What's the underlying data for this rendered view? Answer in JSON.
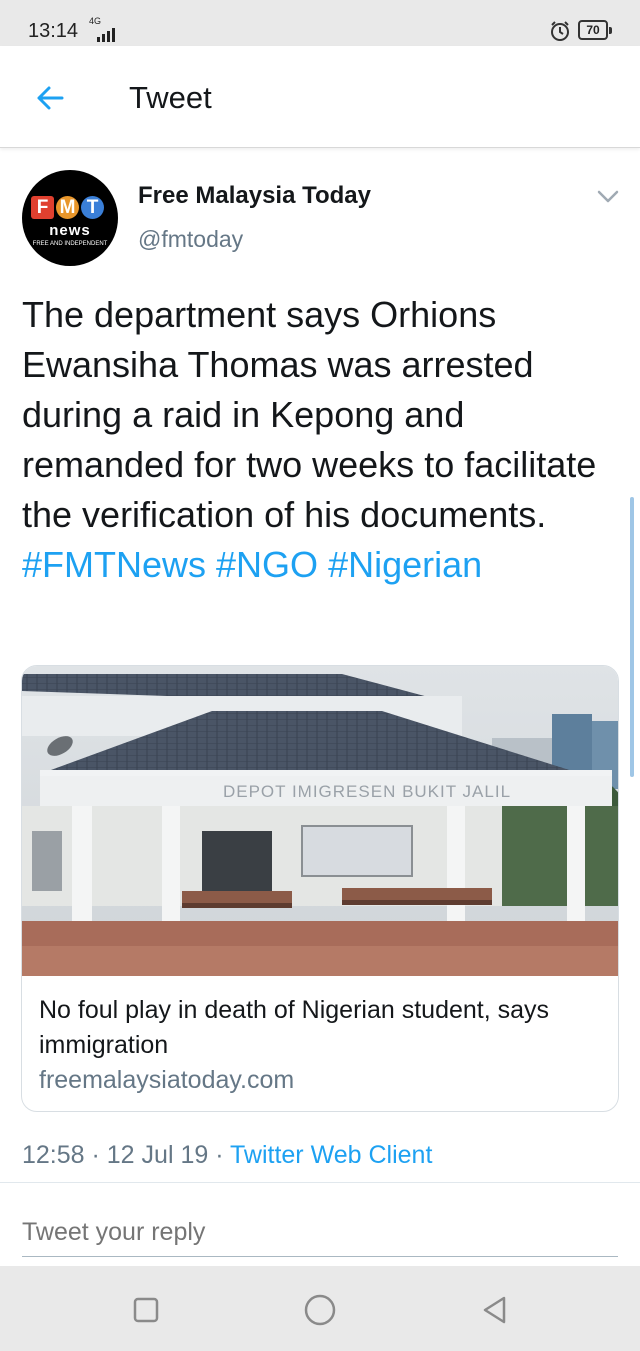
{
  "status_bar": {
    "time": "13:14",
    "network": "4G",
    "battery": "70"
  },
  "header": {
    "title": "Tweet",
    "back_icon": "arrow-left-icon"
  },
  "tweet": {
    "author_name": "Free Malaysia Today",
    "author_handle": "@fmtoday",
    "avatar": {
      "letters": [
        "F",
        "M",
        "T"
      ],
      "letter_colors": [
        "#e0402f",
        "#e8962b",
        "#3a7fd8"
      ],
      "wordmark": "news",
      "tagline": "FREE AND INDEPENDENT"
    },
    "text_parts": [
      {
        "text": "The department says Orhions Ewansiha Thomas was arrested during a raid in Kepong and remanded for two weeks to facilitate the verification of his documents. ",
        "hashtag": false
      },
      {
        "text": "#FMTNews",
        "hashtag": true
      },
      {
        "text": " ",
        "hashtag": false
      },
      {
        "text": "#NGO",
        "hashtag": true
      },
      {
        "text": " ",
        "hashtag": false
      },
      {
        "text": "#Nigerian",
        "hashtag": true
      }
    ],
    "card": {
      "image_sign": "DEPOT IMIGRESEN BUKIT JALIL",
      "title": "No foul play in death of Nigerian student, says immigration",
      "domain": "freemalaysiatoday.com"
    },
    "meta": {
      "time": "12:58",
      "separator": " · ",
      "date": "12 Jul 19",
      "client": "Twitter Web Client"
    }
  },
  "reply": {
    "placeholder": "Tweet your reply"
  },
  "colors": {
    "accent": "#1da1f2",
    "secondary_text": "#657786",
    "primary_text": "#14171a"
  }
}
